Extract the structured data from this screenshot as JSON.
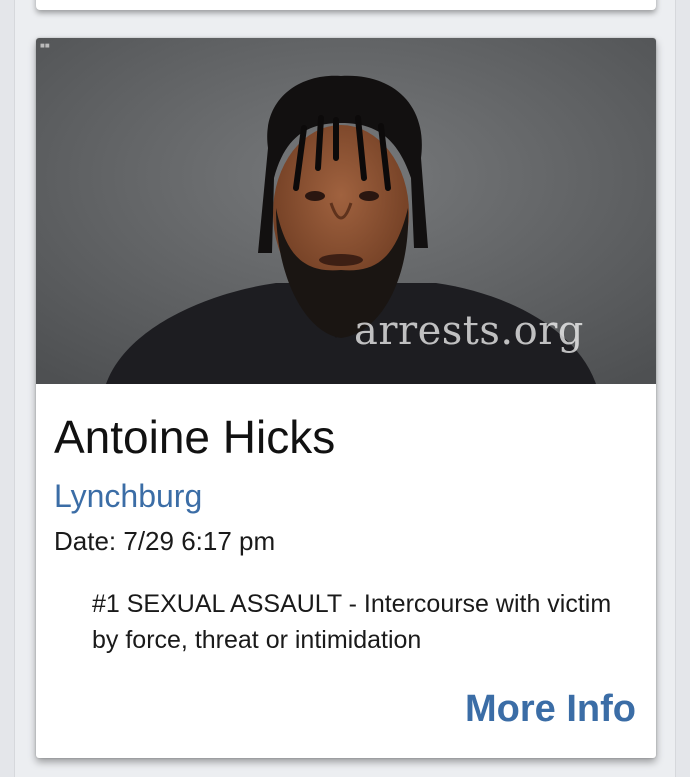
{
  "watermark": "arrests.org",
  "arrest": {
    "name": "Antoine Hicks",
    "city": "Lynchburg",
    "date": "Date: 7/29 6:17 pm",
    "charges": [
      "#1 SEXUAL ASSAULT - Intercourse with victim by force, threat or intimidation"
    ]
  },
  "actions": {
    "more_info": "More Info"
  },
  "icons": {
    "photo": "mugshot-photo"
  },
  "colors": {
    "link": "#3b6da6",
    "text": "#111111",
    "card_bg": "#ffffff",
    "photo_bg": "#5a5c5e"
  }
}
